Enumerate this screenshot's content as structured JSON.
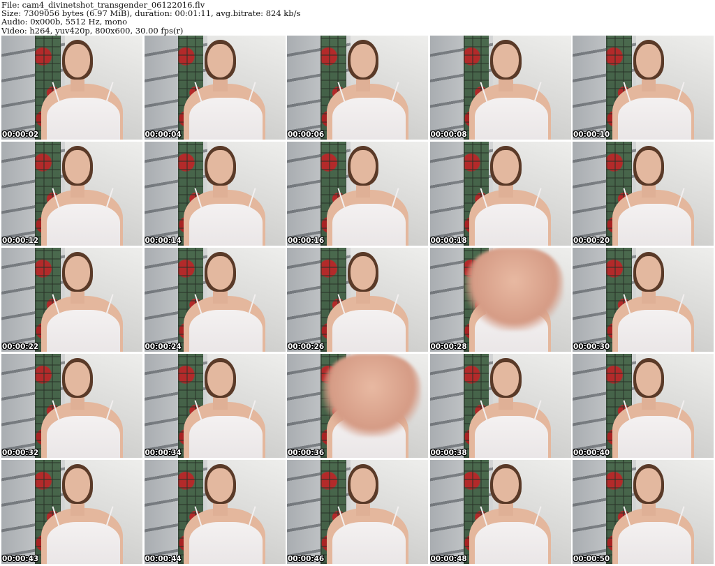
{
  "header": {
    "file": "File: cam4_divinetshot_transgender_06122016.flv",
    "size": "Size: 7309056 bytes (6.97 MiB), duration: 00:01:11, avg.bitrate: 824 kb/s",
    "audio": "Audio: 0x000b, 5512 Hz, mono",
    "video": "Video: h264, yuv420p, 800x600, 30.00 fps(r)"
  },
  "thumbnails": [
    {
      "timestamp": "00:00:02"
    },
    {
      "timestamp": "00:00:04"
    },
    {
      "timestamp": "00:00:06"
    },
    {
      "timestamp": "00:00:08"
    },
    {
      "timestamp": "00:00:10"
    },
    {
      "timestamp": "00:00:12"
    },
    {
      "timestamp": "00:00:14"
    },
    {
      "timestamp": "00:00:16"
    },
    {
      "timestamp": "00:00:18"
    },
    {
      "timestamp": "00:00:20"
    },
    {
      "timestamp": "00:00:22"
    },
    {
      "timestamp": "00:00:24"
    },
    {
      "timestamp": "00:00:26"
    },
    {
      "timestamp": "00:00:28"
    },
    {
      "timestamp": "00:00:30"
    },
    {
      "timestamp": "00:00:32"
    },
    {
      "timestamp": "00:00:34"
    },
    {
      "timestamp": "00:00:36"
    },
    {
      "timestamp": "00:00:38"
    },
    {
      "timestamp": "00:00:40"
    },
    {
      "timestamp": "00:00:43"
    },
    {
      "timestamp": "00:00:44"
    },
    {
      "timestamp": "00:00:46"
    },
    {
      "timestamp": "00:00:48"
    },
    {
      "timestamp": "00:00:50"
    }
  ]
}
